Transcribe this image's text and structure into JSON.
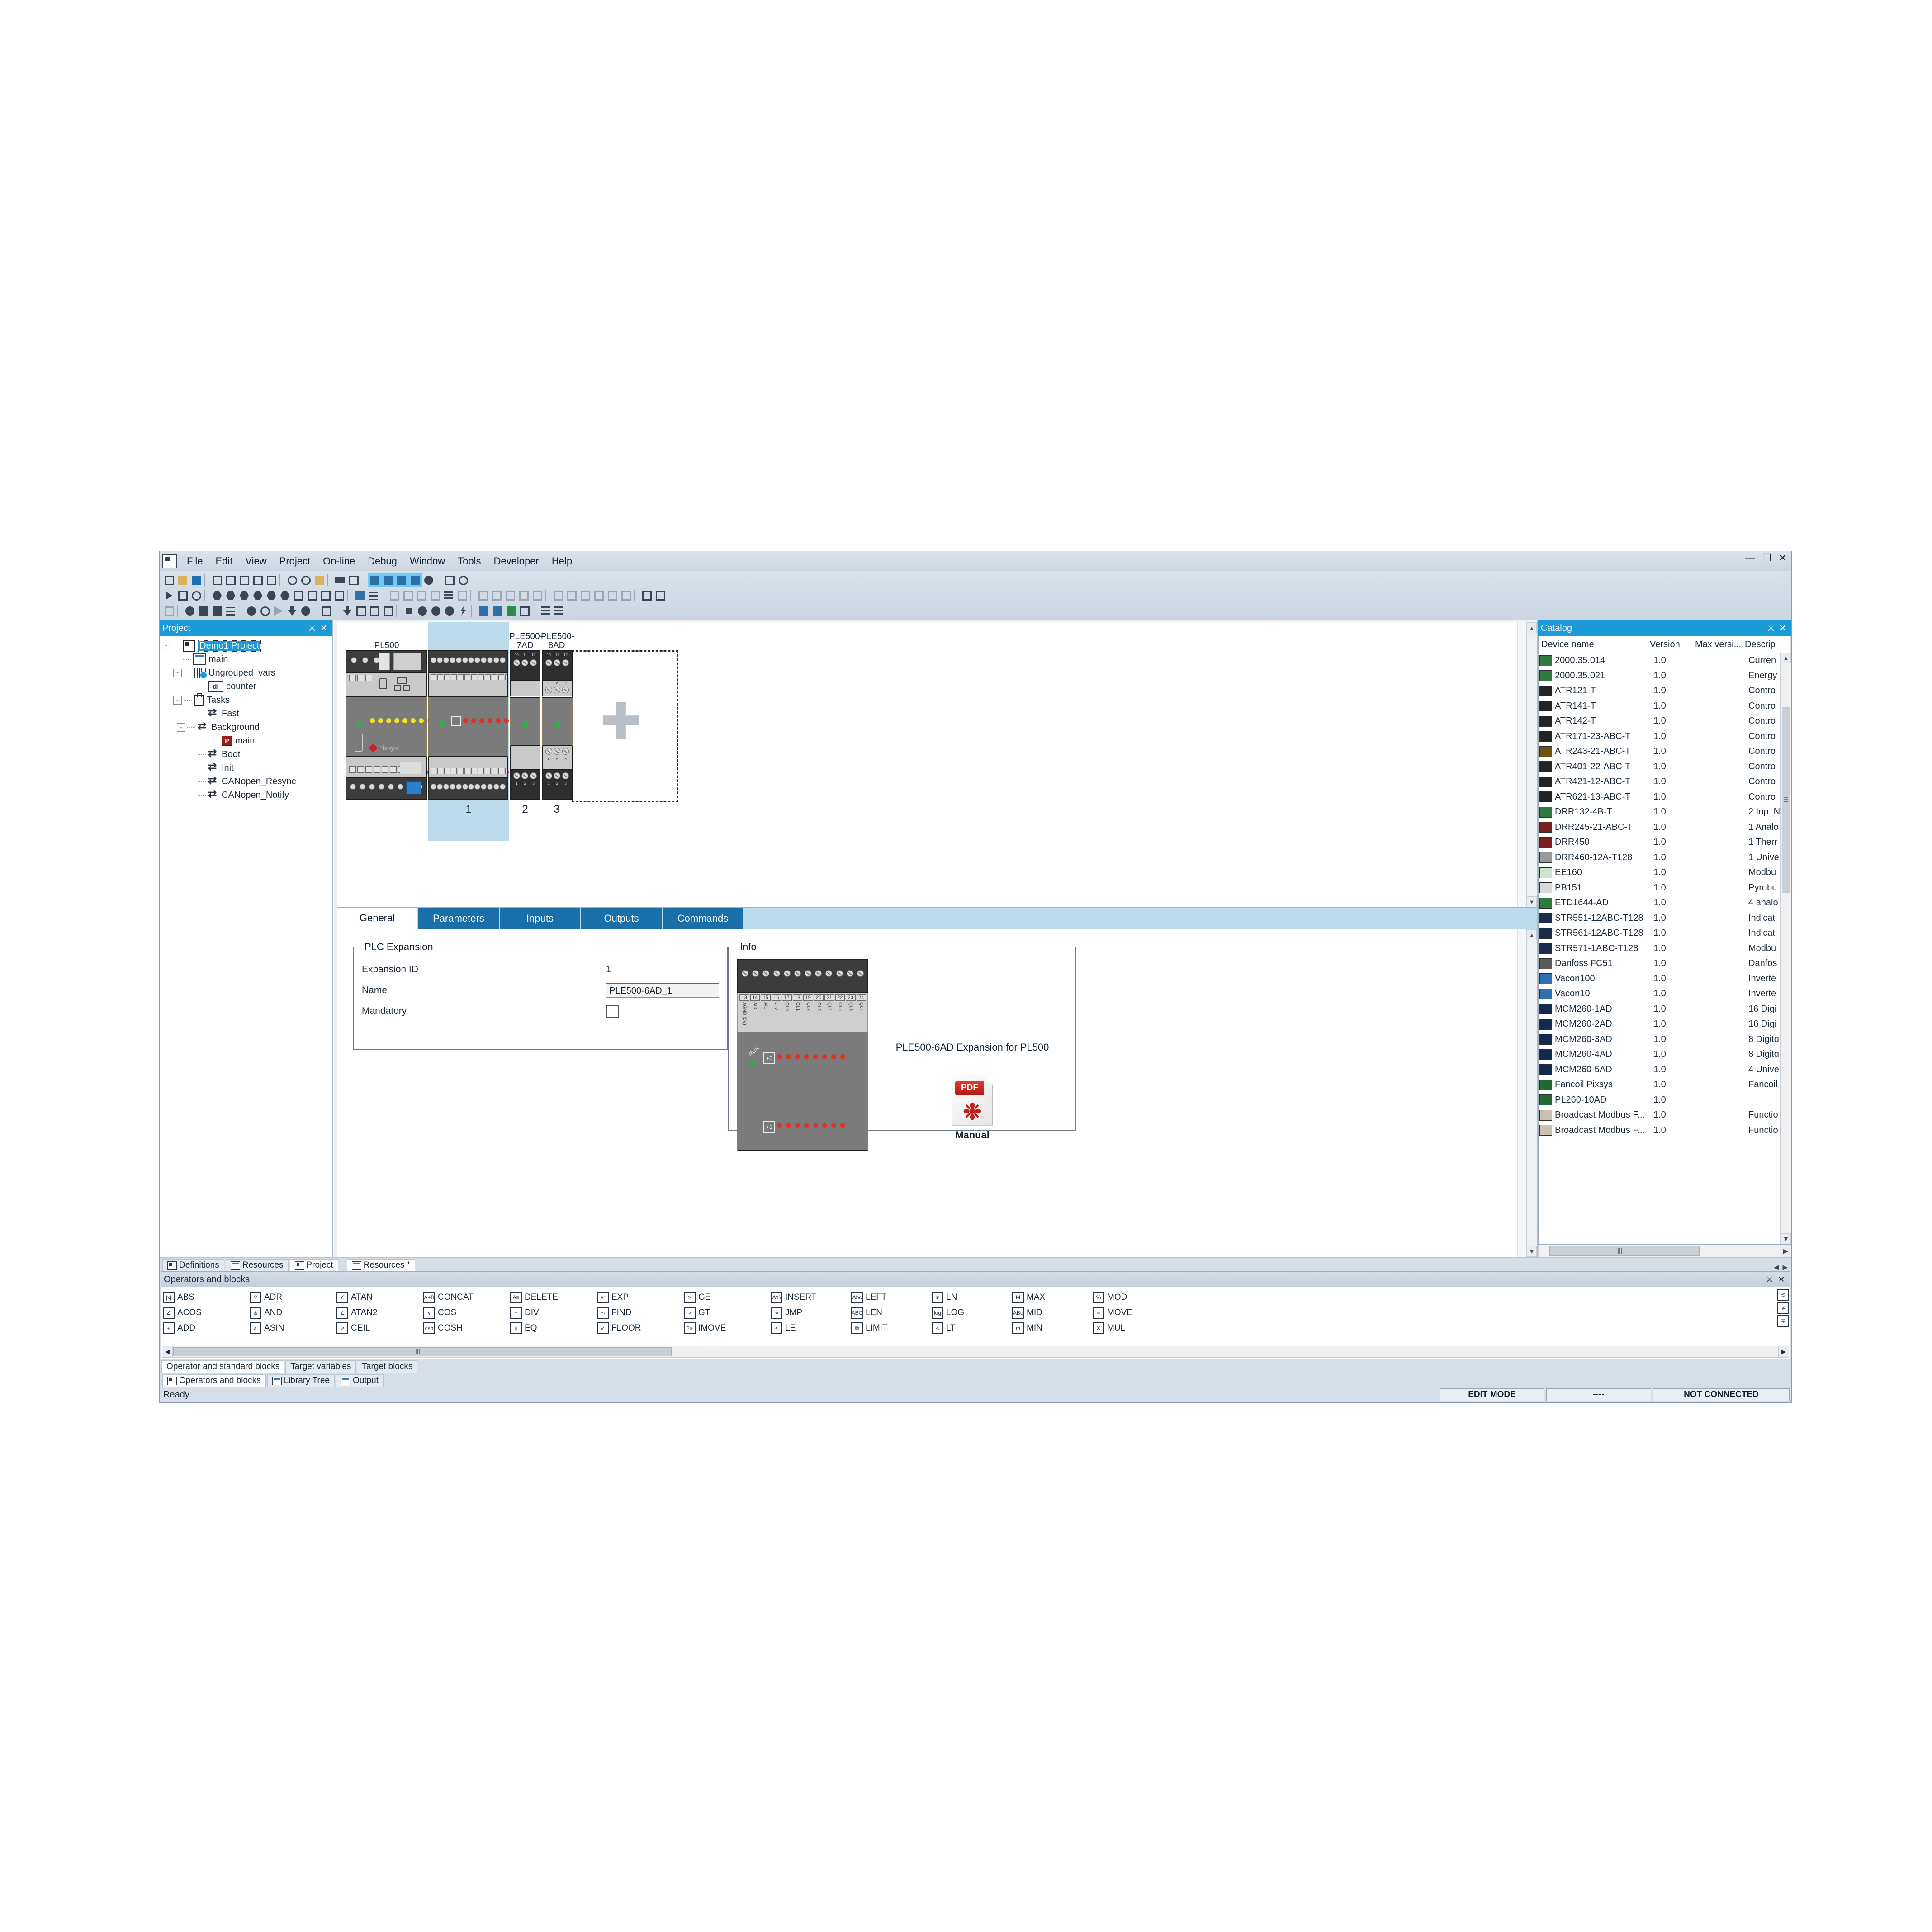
{
  "window": {
    "minimize": "—",
    "restore": "❐",
    "close": "✕"
  },
  "menubar": {
    "items": [
      "File",
      "Edit",
      "View",
      "Project",
      "On-line",
      "Debug",
      "Window",
      "Tools",
      "Developer",
      "Help"
    ]
  },
  "project_panel": {
    "title": "Project",
    "pin": "⚔",
    "close": "✕",
    "tree": [
      {
        "label": "Demo1 Project",
        "icon": "project-icon",
        "indent": 0,
        "expander": "-",
        "selected": true
      },
      {
        "label": "main",
        "icon": "program-icon",
        "indent": 1,
        "expander": "",
        "selected": false
      },
      {
        "label": "Ungrouped_vars",
        "icon": "variables-grid-icon",
        "indent": 1,
        "expander": "-",
        "selected": false
      },
      {
        "label": "counter",
        "icon": "di-variable-icon",
        "indent": 2,
        "expander": "",
        "selected": false
      },
      {
        "label": "Tasks",
        "icon": "tasks-bag-icon",
        "indent": 1,
        "expander": "-",
        "selected": false
      },
      {
        "label": "Fast",
        "icon": "task-icon",
        "indent": 2,
        "expander": "",
        "selected": false
      },
      {
        "label": "Background",
        "icon": "task-icon",
        "indent": 2,
        "expander": "-",
        "selected": false
      },
      {
        "label": "main",
        "icon": "program-red-icon",
        "indent": 3,
        "expander": "",
        "selected": false
      },
      {
        "label": "Boot",
        "icon": "task-icon",
        "indent": 2,
        "expander": "",
        "selected": false
      },
      {
        "label": "Init",
        "icon": "task-icon",
        "indent": 2,
        "expander": "",
        "selected": false
      },
      {
        "label": "CANopen_Resync",
        "icon": "task-icon",
        "indent": 2,
        "expander": "",
        "selected": false
      },
      {
        "label": "CANopen_Notify",
        "icon": "task-icon",
        "indent": 2,
        "expander": "",
        "selected": false
      }
    ]
  },
  "hardware_view": {
    "modules": [
      {
        "name": "PL500",
        "slot": "",
        "selected": false
      },
      {
        "name": "PLE500-6AD",
        "slot": "1",
        "selected": true
      },
      {
        "name": "PLE500-7AD",
        "slot": "2",
        "selected": false
      },
      {
        "name": "PLE500-8AD",
        "slot": "3",
        "selected": false
      }
    ],
    "add_slot_icon": "plus-icon",
    "brand": "Pixsys"
  },
  "tabs": {
    "items": [
      {
        "label": "General",
        "active": true
      },
      {
        "label": "Parameters",
        "active": false
      },
      {
        "label": "Inputs",
        "active": false
      },
      {
        "label": "Outputs",
        "active": false
      },
      {
        "label": "Commands",
        "active": false
      }
    ]
  },
  "plc_expansion": {
    "legend": "PLC Expansion",
    "fields": [
      {
        "label": "Expansion ID",
        "value": "1",
        "type": "text-readonly"
      },
      {
        "label": "Name",
        "value": "PLE500-6AD_1",
        "type": "textbox"
      },
      {
        "label": "Mandatory",
        "value": "",
        "type": "checkbox",
        "checked": false
      }
    ]
  },
  "info": {
    "legend": "Info",
    "caption": "PLE500-6AD Expansion for PL500",
    "manual_label": "Manual",
    "pdf_badge": "PDF",
    "terminal_numbers": [
      "13",
      "14",
      "15",
      "16",
      "17",
      "18",
      "19",
      "20",
      "21",
      "22",
      "23",
      "24"
    ],
    "terminal_names": [
      "AGND (0V)",
      "AI0",
      "AI1",
      "L+0",
      "QI.0",
      "QI.1",
      "QI.2",
      "QI.3",
      "QI.4",
      "QI.5",
      "QI.6",
      "QI.7"
    ],
    "run_label": "RUN",
    "row0_label": "+0",
    "row1_label": "+1"
  },
  "catalog": {
    "title": "Catalog",
    "pin": "⚔",
    "close": "✕",
    "columns": [
      "Device name",
      "Version",
      "Max versi...",
      "Descrip"
    ],
    "sort_indicator": "⌃",
    "rows": [
      {
        "name": "2000.35.014",
        "version": "1.0",
        "max_version": "",
        "description": "Curren"
      },
      {
        "name": "2000.35.021",
        "version": "1.0",
        "max_version": "",
        "description": "Energy"
      },
      {
        "name": "ATR121-T",
        "version": "1.0",
        "max_version": "",
        "description": "Contro"
      },
      {
        "name": "ATR141-T",
        "version": "1.0",
        "max_version": "",
        "description": "Contro"
      },
      {
        "name": "ATR142-T",
        "version": "1.0",
        "max_version": "",
        "description": "Contro"
      },
      {
        "name": "ATR171-23-ABC-T",
        "version": "1.0",
        "max_version": "",
        "description": "Contro"
      },
      {
        "name": "ATR243-21-ABC-T",
        "version": "1.0",
        "max_version": "",
        "description": "Contro"
      },
      {
        "name": "ATR401-22-ABC-T",
        "version": "1.0",
        "max_version": "",
        "description": "Contro"
      },
      {
        "name": "ATR421-12-ABC-T",
        "version": "1.0",
        "max_version": "",
        "description": "Contro"
      },
      {
        "name": "ATR621-13-ABC-T",
        "version": "1.0",
        "max_version": "",
        "description": "Contro"
      },
      {
        "name": "DRR132-4B-T",
        "version": "1.0",
        "max_version": "",
        "description": "2 Inp. N"
      },
      {
        "name": "DRR245-21-ABC-T",
        "version": "1.0",
        "max_version": "",
        "description": "1 Analo"
      },
      {
        "name": "DRR450",
        "version": "1.0",
        "max_version": "",
        "description": "1 Therr"
      },
      {
        "name": "DRR460-12A-T128",
        "version": "1.0",
        "max_version": "",
        "description": "1 Unive"
      },
      {
        "name": "EE160",
        "version": "1.0",
        "max_version": "",
        "description": "Modbu"
      },
      {
        "name": "PB151",
        "version": "1.0",
        "max_version": "",
        "description": "Pyrobu"
      },
      {
        "name": "ETD1644-AD",
        "version": "1.0",
        "max_version": "",
        "description": "4 analo"
      },
      {
        "name": "STR551-12ABC-T128",
        "version": "1.0",
        "max_version": "",
        "description": "Indicat"
      },
      {
        "name": "STR561-12ABC-T128",
        "version": "1.0",
        "max_version": "",
        "description": "Indicat"
      },
      {
        "name": "STR571-1ABC-T128",
        "version": "1.0",
        "max_version": "",
        "description": "Modbu"
      },
      {
        "name": "Danfoss FC51",
        "version": "1.0",
        "max_version": "",
        "description": "Danfos"
      },
      {
        "name": "Vacon100",
        "version": "1.0",
        "max_version": "",
        "description": "Inverte"
      },
      {
        "name": "Vacon10",
        "version": "1.0",
        "max_version": "",
        "description": "Inverte"
      },
      {
        "name": "MCM260-1AD",
        "version": "1.0",
        "max_version": "",
        "description": "16 Digi"
      },
      {
        "name": "MCM260-2AD",
        "version": "1.0",
        "max_version": "",
        "description": "16 Digi"
      },
      {
        "name": "MCM260-3AD",
        "version": "1.0",
        "max_version": "",
        "description": "8 Digitɑ"
      },
      {
        "name": "MCM260-4AD",
        "version": "1.0",
        "max_version": "",
        "description": "8 Digitɑ"
      },
      {
        "name": "MCM260-5AD",
        "version": "1.0",
        "max_version": "",
        "description": "4 Unive"
      },
      {
        "name": "Fancoil Pixsys",
        "version": "1.0",
        "max_version": "",
        "description": "Fancoil"
      },
      {
        "name": "PL260-10AD",
        "version": "1.0",
        "max_version": "",
        "description": ""
      },
      {
        "name": "Broadcast Modbus F...",
        "version": "1.0",
        "max_version": "",
        "description": "Functio"
      },
      {
        "name": "Broadcast Modbus F...",
        "version": "1.0",
        "max_version": "",
        "description": "Functio"
      }
    ]
  },
  "doc_tabs": {
    "items": [
      {
        "label": "Definitions",
        "active": false
      },
      {
        "label": "Resources",
        "active": false
      },
      {
        "label": "Project",
        "active": true
      },
      {
        "label": "Resources *",
        "active": true,
        "spaced": true
      }
    ],
    "nav_left": "◀",
    "nav_right": "▶"
  },
  "operators_panel": {
    "title": "Operators and blocks",
    "pin": "⚔",
    "close": "✕",
    "columns": [
      {
        "items": [
          "ABS",
          "ACOS",
          "ADD"
        ]
      },
      {
        "items": [
          "ADR",
          "AND",
          "ASIN"
        ]
      },
      {
        "items": [
          "ATAN",
          "ATAN2",
          "CEIL"
        ]
      },
      {
        "items": [
          "CONCAT",
          "COS",
          "COSH"
        ]
      },
      {
        "items": [
          "DELETE",
          "DIV",
          "EQ"
        ]
      },
      {
        "items": [
          "EXP",
          "FIND",
          "FLOOR"
        ]
      },
      {
        "items": [
          "GE",
          "GT",
          "IMOVE"
        ]
      },
      {
        "items": [
          "INSERT",
          "JMP",
          "LE"
        ]
      },
      {
        "items": [
          "LEFT",
          "LEN",
          "LIMIT"
        ]
      },
      {
        "items": [
          "LN",
          "LOG",
          "LT"
        ]
      },
      {
        "items": [
          "MAX",
          "MID",
          "MIN"
        ]
      },
      {
        "items": [
          "MOD",
          "MOVE",
          "MUL"
        ]
      }
    ]
  },
  "sub_tabs": {
    "items": [
      {
        "label": "Operator and standard blocks",
        "active": true
      },
      {
        "label": "Target variables",
        "active": false
      },
      {
        "label": "Target blocks",
        "active": false
      }
    ]
  },
  "bottom_tabs": {
    "items": [
      {
        "label": "Operators and blocks",
        "active": true
      },
      {
        "label": "Library Tree",
        "active": false
      },
      {
        "label": "Output",
        "active": false
      }
    ]
  },
  "statusbar": {
    "ready": "Ready",
    "mode": "EDIT MODE",
    "middle": "----",
    "connection": "NOT CONNECTED"
  }
}
